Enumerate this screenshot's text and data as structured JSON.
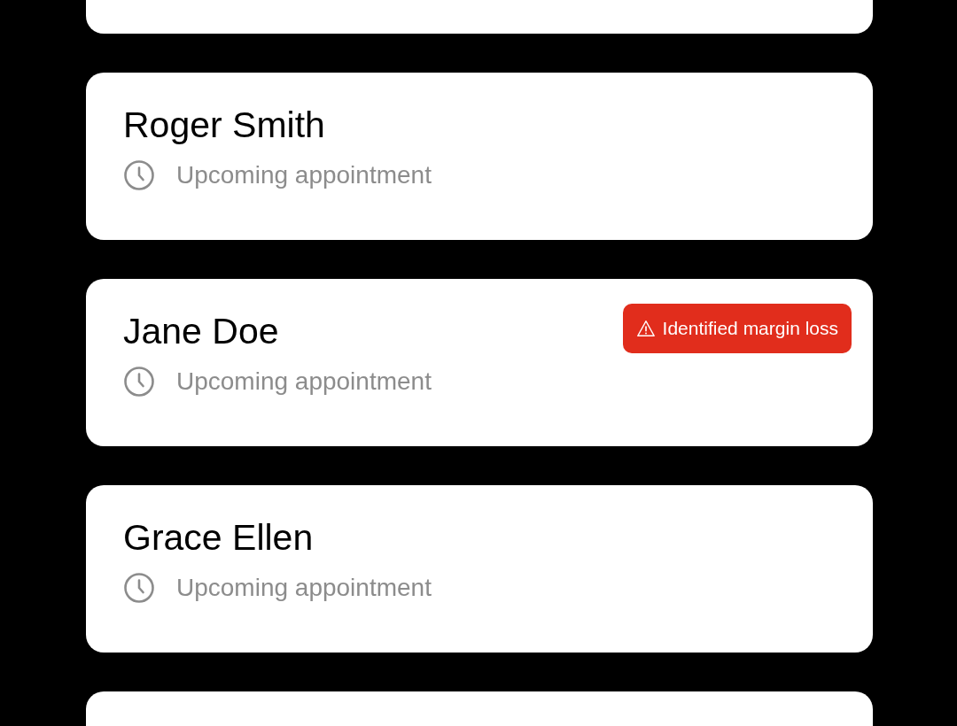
{
  "clients": [
    {
      "name": "Roger Smith",
      "status": "Upcoming appointment"
    },
    {
      "name": "Jane Doe",
      "status": "Upcoming appointment",
      "badge": {
        "text": "Identified margin loss"
      }
    },
    {
      "name": "Grace Ellen",
      "status": "Upcoming appointment"
    }
  ]
}
